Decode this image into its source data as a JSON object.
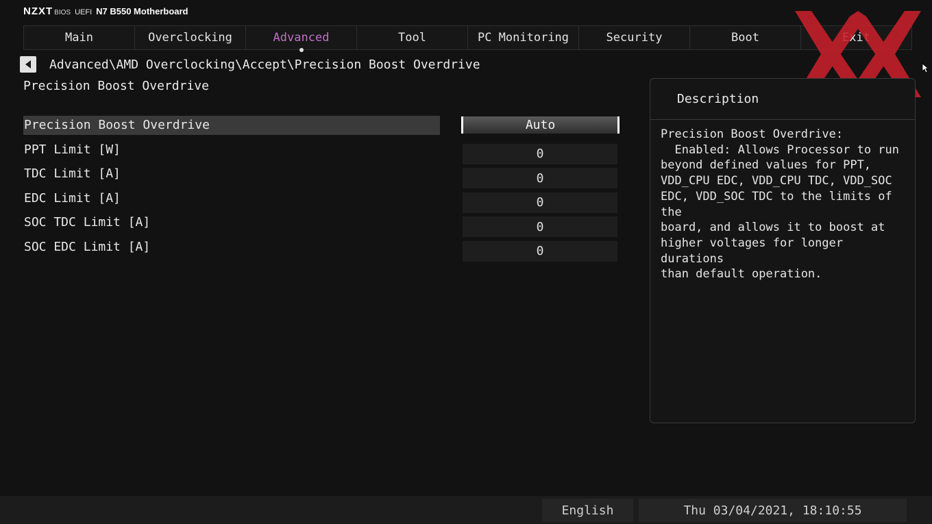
{
  "brand": {
    "logo": "NZXT",
    "bios": "BIOS",
    "uefi": "UEFI",
    "model": "N7 B550 Motherboard"
  },
  "tabs": [
    {
      "label": "Main"
    },
    {
      "label": "Overclocking"
    },
    {
      "label": "Advanced",
      "active": true
    },
    {
      "label": "Tool"
    },
    {
      "label": "PC Monitoring"
    },
    {
      "label": "Security"
    },
    {
      "label": "Boot"
    },
    {
      "label": "Exit"
    }
  ],
  "breadcrumb": "Advanced\\AMD Overclocking\\Accept\\Precision Boost Overdrive",
  "page_title": "Precision Boost Overdrive",
  "settings": [
    {
      "label": "Precision Boost Overdrive",
      "value": "Auto"
    },
    {
      "label": "PPT Limit [W]",
      "value": "0"
    },
    {
      "label": "TDC Limit [A]",
      "value": "0"
    },
    {
      "label": "EDC Limit [A]",
      "value": "0"
    },
    {
      "label": "SOC TDC Limit [A]",
      "value": "0"
    },
    {
      "label": "SOC EDC Limit [A]",
      "value": "0"
    }
  ],
  "description": {
    "title": "Description",
    "text": "Precision Boost Overdrive:\n  Enabled: Allows Processor to run\nbeyond defined values for PPT,\nVDD_CPU EDC, VDD_CPU TDC, VDD_SOC\nEDC, VDD_SOC TDC to the limits of the\nboard, and allows it to boost at\nhigher voltages for longer durations\nthan default operation."
  },
  "footer": {
    "language": "English",
    "datetime": "Thu 03/04/2021, 18:10:55"
  },
  "colors": {
    "active_tab": "#c070c8",
    "watermark": "#c8202a"
  }
}
